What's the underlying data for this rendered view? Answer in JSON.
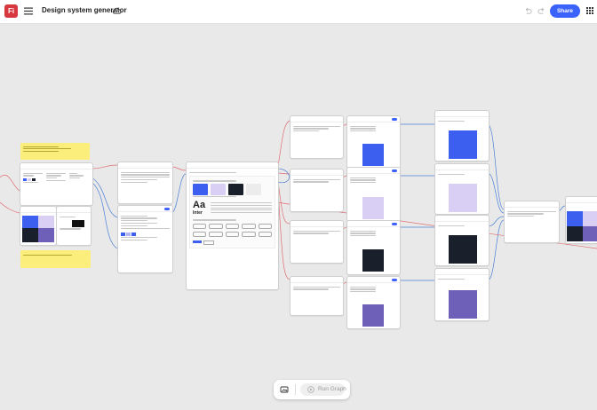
{
  "app": {
    "logo_text": "Fi",
    "title": "Design system generator",
    "share_label": "Share",
    "accent": "#3b63fb",
    "brand": "#d7373f"
  },
  "toolbar": {
    "icons": [
      "menu-icon",
      "cloud-icon",
      "undo-icon",
      "redo-icon",
      "apps-icon"
    ]
  },
  "run": {
    "label": "Run Graph",
    "icons": [
      "image-icon",
      "play-icon"
    ]
  },
  "nodes": {
    "typography_sample": "Aa",
    "typography_font": "Inter"
  },
  "swatches": {
    "blue": "#3d5ff0",
    "lavender": "#d9cff5",
    "dark": "#1a1f2c",
    "violet": "#6e5fb8",
    "light": "#ececec"
  }
}
